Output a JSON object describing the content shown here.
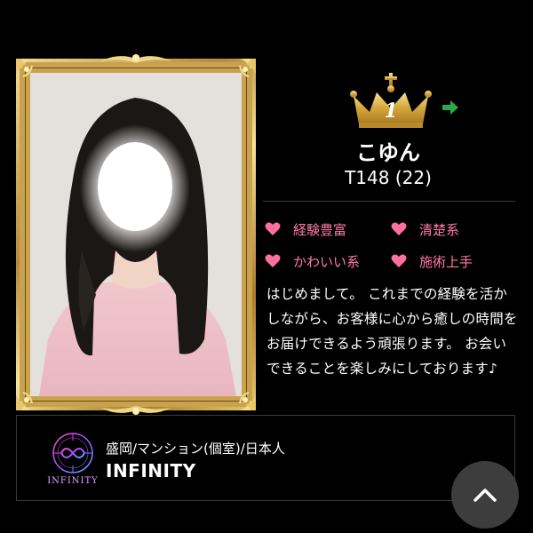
{
  "cast": {
    "rank": "1",
    "name": "こゆん",
    "meta": "T148 (22)",
    "tags": [
      "経験豊富",
      "清楚系",
      "かわいい系",
      "施術上手"
    ],
    "description": "はじめまして。 これまでの経験を活かしながら、お客様に心から癒しの時間をお届けできるよう頑張ります。 お会いできることを楽しみにしております♪"
  },
  "shop": {
    "location": "盛岡/マンション(個室)/日本人",
    "name": "INFINITY",
    "logo_text": "INFINITY"
  },
  "icons": {
    "rank": "crown-icon",
    "next": "arrow-right-icon",
    "tag": "heart-icon",
    "scroll_top": "chevron-up-icon"
  },
  "colors": {
    "background": "#000000",
    "gold": "#c9a24f",
    "tag_pink": "#ff7aa8",
    "arrow_green": "#2ea84a",
    "scroll_button": "#3d3d3d"
  }
}
